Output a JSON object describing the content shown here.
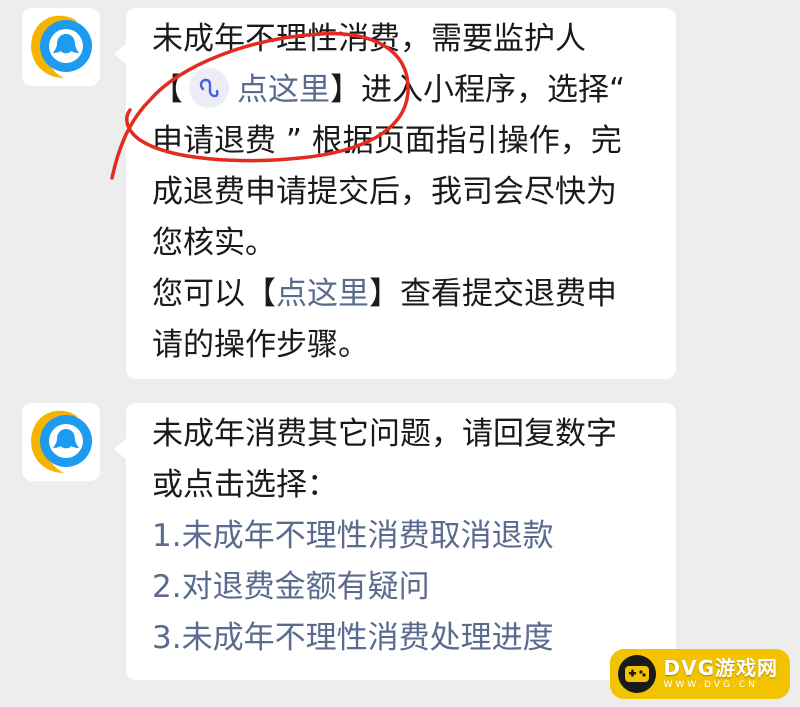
{
  "colors": {
    "background": "#ededed",
    "bubble": "#ffffff",
    "link": "#5b6b8f",
    "annotation": "#e32b1f",
    "watermark": "#f2c300"
  },
  "messages": [
    {
      "avatar_icon": "qq-service-avatar-icon",
      "line1": "未成年不理性消费，需要监护人",
      "line2_open": "【",
      "line2_icon": "mini-program-icon",
      "line2_link": "点这里",
      "line2_rest": "】进入小程序，选择“",
      "line3": "申请退费 ” 根据页面指引操作，完",
      "line4": "成退费申请提交后，我司会尽快为",
      "line5": "您核实。",
      "line6_pre": "您可以【",
      "line6_link": "点这里",
      "line6_post": "】查看提交退费申",
      "line7": "请的操作步骤。"
    },
    {
      "avatar_icon": "qq-service-avatar-icon",
      "line1": "未成年消费其它问题，请回复数字",
      "line2": "或点击选择：",
      "options": [
        "1.未成年不理性消费取消退款",
        "2.对退费金额有疑问",
        "3.未成年不理性消费处理进度"
      ]
    }
  ],
  "watermark": {
    "title": "DVG游戏网",
    "url": "WWW.DVG.CN"
  }
}
